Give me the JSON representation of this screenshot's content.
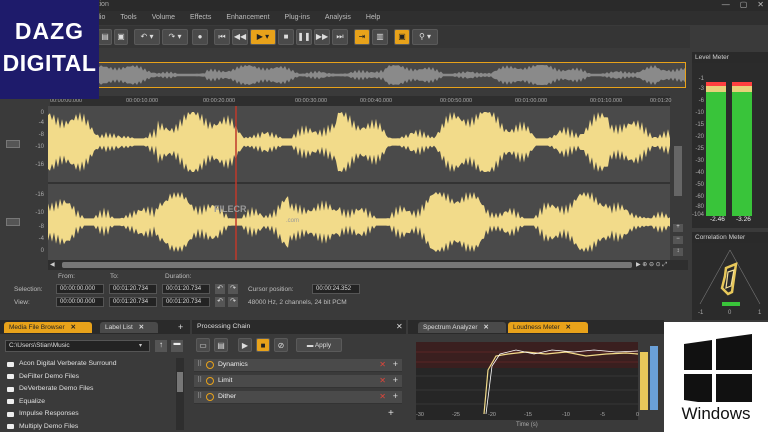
{
  "window": {
    "title": "ition",
    "controls": [
      "—",
      "▢",
      "✕"
    ]
  },
  "menu": [
    "dio",
    "Tools",
    "Volume",
    "Effects",
    "Enhancement",
    "Plug-ins",
    "Analysis",
    "Help"
  ],
  "ruler": {
    "ticks": [
      "00:00:00.000",
      "00:00:10.000",
      "00:00:20.000",
      "00:00:30.000",
      "00:00:40.000",
      "00:00:50.000",
      "00:01:00.000",
      "00:01:10.000",
      "00:01:20"
    ]
  },
  "track_scale": [
    "0",
    "-4",
    "-8",
    "-10",
    "-16",
    "-16",
    "-10",
    "-8",
    "-4",
    "0"
  ],
  "watermark": {
    "brand": "FILECR",
    "sub": ".com"
  },
  "selection": {
    "from_label": "From:",
    "to_label": "To:",
    "duration_label": "Duration:",
    "selection_label": "Selection:",
    "view_label": "View:",
    "sel_from": "00:00:00.000",
    "sel_to": "00:01:20.734",
    "sel_dur": "00:01:20.734",
    "view_from": "00:00:00.000",
    "view_to": "00:01:20.734",
    "view_dur": "00:01:20.734",
    "cursor_label": "Cursor position:",
    "cursor_value": "00:00:24.352",
    "format": "48000 Hz, 2 channels, 24 bit PCM"
  },
  "level_meter": {
    "title": "Level Meter",
    "scale": [
      "-1",
      "-3",
      "-6",
      "-10",
      "-15",
      "-20",
      "-25",
      "-30",
      "-40",
      "-50",
      "-60",
      "-80",
      "-104"
    ],
    "left_peak": "-2.46",
    "right_peak": "-3.26"
  },
  "correlation_meter": {
    "title": "Correlation Meter",
    "scale": [
      "-1",
      "0",
      "1"
    ]
  },
  "browser": {
    "tabs": [
      "Media File Browser",
      "Label List"
    ],
    "path": "C:\\Users\\Stian\\Music",
    "items": [
      "Acon Digital Verberate Surround",
      "DeFilter Demo Files",
      "DeVerberate Demo Files",
      "Equalize",
      "Impulse Responses",
      "Multiply Demo Files"
    ]
  },
  "processing": {
    "title": "Processing Chain",
    "apply_label": "Apply",
    "items": [
      "Dynamics",
      "Limit",
      "Dither"
    ]
  },
  "analysis": {
    "tabs": [
      "Spectrum Analyzer",
      "Loudness Meter"
    ],
    "x_ticks": [
      "-30",
      "-25",
      "-20",
      "-15",
      "-10",
      "-5",
      "0"
    ],
    "x_label": "Time (s)"
  },
  "overlay": {
    "logo_line1": "DAZG",
    "logo_line2": "DIGITAL",
    "os_label": "Windows"
  },
  "colors": {
    "accent": "#e8a21a",
    "wave": "#f2db8a",
    "meter_green": "#39c43a",
    "cursor": "#c0392b"
  }
}
